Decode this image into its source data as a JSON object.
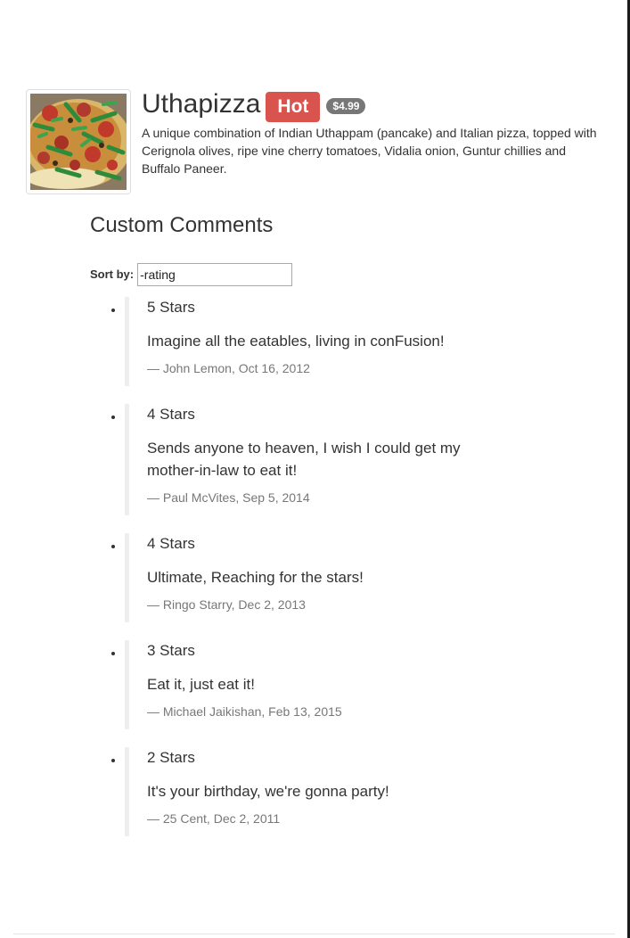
{
  "dish": {
    "image_alt": "Uthapizza",
    "name": "Uthapizza",
    "label": "Hot",
    "price": "$4.99",
    "description": "A unique combination of Indian Uthappam (pancake) and Italian pizza, topped with Cerignola olives, ripe vine cherry tomatoes, Vidalia onion, Guntur chillies and Buffalo Paneer."
  },
  "comments_section": {
    "title": "Custom Comments",
    "sort_label": "Sort by:",
    "sort_value": "-rating"
  },
  "comments": [
    {
      "stars": "5 Stars",
      "text": "Imagine all the eatables, living in conFusion!",
      "footer": "— John Lemon, Oct 16, 2012"
    },
    {
      "stars": "4 Stars",
      "text": "Sends anyone to heaven, I wish I could get my mother-in-law to eat it!",
      "footer": "— Paul McVites, Sep 5, 2014"
    },
    {
      "stars": "4 Stars",
      "text": "Ultimate, Reaching for the stars!",
      "footer": "— Ringo Starry, Dec 2, 2013"
    },
    {
      "stars": "3 Stars",
      "text": "Eat it, just eat it!",
      "footer": "— Michael Jaikishan, Feb 13, 2015"
    },
    {
      "stars": "2 Stars",
      "text": "It's your birthday, we're gonna party!",
      "footer": "— 25 Cent, Dec 2, 2011"
    }
  ],
  "colors": {
    "label_danger": "#d9534f",
    "badge_default": "#777777",
    "blockquote_border": "#eeeeee",
    "muted_text": "#777777"
  }
}
